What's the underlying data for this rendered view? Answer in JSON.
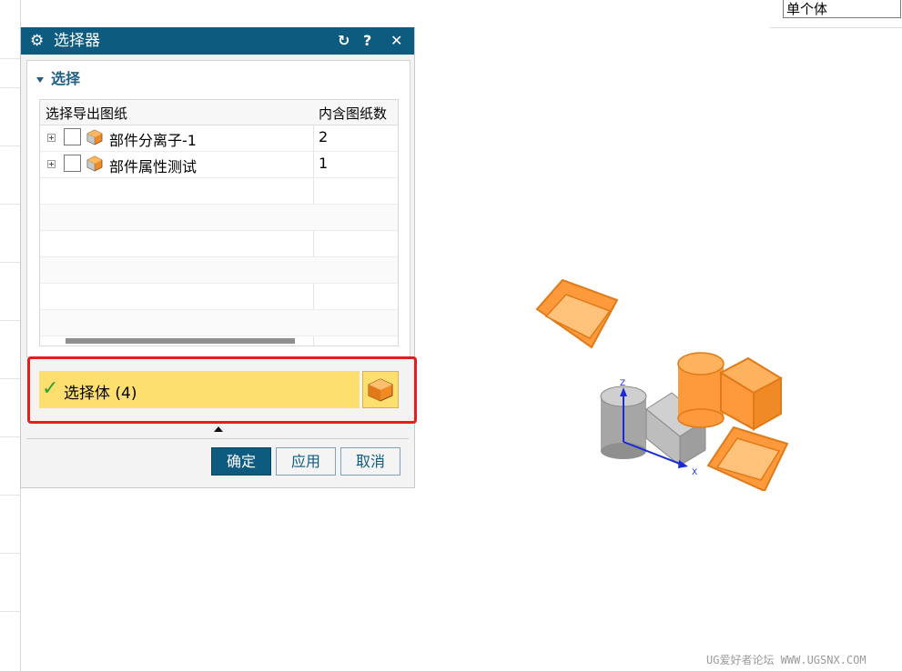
{
  "filter": {
    "value": "单个体"
  },
  "dialog": {
    "title": "选择器",
    "group_title": "选择",
    "table": {
      "columns": [
        "选择导出图纸",
        "内含图纸数"
      ],
      "rows": [
        {
          "name": "部件分离子-1",
          "count": "2"
        },
        {
          "name": "部件属性测试",
          "count": "1"
        }
      ]
    },
    "selection": {
      "label": "选择体 (4)"
    },
    "buttons": {
      "ok": "确定",
      "apply": "应用",
      "cancel": "取消"
    }
  },
  "viewport": {
    "axis_z": "Z",
    "axis_x": "X",
    "highlight_color": "#ff9a3c"
  },
  "watermark": "UG爱好者论坛 WWW.UGSNX.COM"
}
